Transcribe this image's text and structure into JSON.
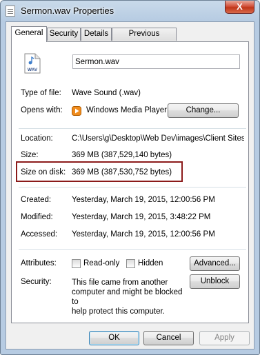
{
  "window": {
    "title": "Sermon.wav Properties",
    "close_label": "X"
  },
  "tabs": [
    {
      "label": "General",
      "active": true
    },
    {
      "label": "Security",
      "active": false
    },
    {
      "label": "Details",
      "active": false
    },
    {
      "label": "Previous Versions",
      "active": false
    }
  ],
  "file": {
    "icon": "wav-file-icon",
    "icon_text": "WAV",
    "name": "Sermon.wav"
  },
  "type": {
    "label": "Type of file:",
    "value": "Wave Sound (.wav)"
  },
  "opens_with": {
    "label": "Opens with:",
    "icon": "windows-media-player-icon",
    "value": "Windows Media Player",
    "change_label": "Change..."
  },
  "location": {
    "label": "Location:",
    "value": "C:\\Users\\g\\Desktop\\Web Dev\\images\\Client Sites\\"
  },
  "size": {
    "label": "Size:",
    "value": "369 MB (387,529,140 bytes)"
  },
  "size_on_disk": {
    "label": "Size on disk:",
    "value": "369 MB (387,530,752 bytes)"
  },
  "created": {
    "label": "Created:",
    "value": "Yesterday, March 19, 2015, 12:00:56 PM"
  },
  "modified": {
    "label": "Modified:",
    "value": "Yesterday, March 19, 2015, 3:48:22 PM"
  },
  "accessed": {
    "label": "Accessed:",
    "value": "Yesterday, March 19, 2015, 12:00:56 PM"
  },
  "attributes": {
    "label": "Attributes:",
    "readonly_label": "Read-only",
    "readonly_checked": false,
    "hidden_label": "Hidden",
    "hidden_checked": false,
    "advanced_label": "Advanced..."
  },
  "security": {
    "label": "Security:",
    "message": "This file came from another\ncomputer and might be blocked to\nhelp protect this computer.",
    "unblock_label": "Unblock"
  },
  "footer": {
    "ok_label": "OK",
    "cancel_label": "Cancel",
    "apply_label": "Apply"
  },
  "colors": {
    "highlight_border": "#8b1a1a",
    "window_frame": "#b6cbe2",
    "close_button": "#c03518"
  }
}
